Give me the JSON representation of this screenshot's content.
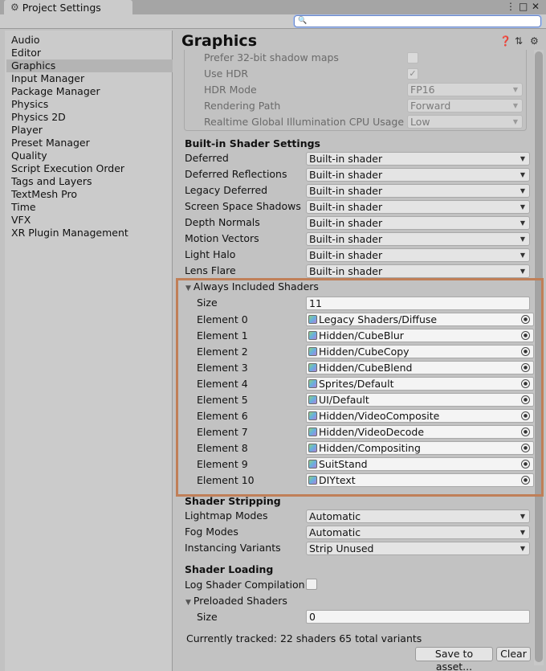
{
  "window": {
    "tab_title": "Project Settings",
    "tab_icon": "gear-icon",
    "controls": [
      "⋮",
      "□",
      "✕"
    ]
  },
  "search": {
    "value": "",
    "placeholder": ""
  },
  "sidebar": {
    "items": [
      {
        "label": "Audio"
      },
      {
        "label": "Editor"
      },
      {
        "label": "Graphics",
        "selected": true
      },
      {
        "label": "Input Manager"
      },
      {
        "label": "Package Manager"
      },
      {
        "label": "Physics"
      },
      {
        "label": "Physics 2D"
      },
      {
        "label": "Player"
      },
      {
        "label": "Preset Manager"
      },
      {
        "label": "Quality"
      },
      {
        "label": "Script Execution Order"
      },
      {
        "label": "Tags and Layers"
      },
      {
        "label": "TextMesh Pro"
      },
      {
        "label": "Time"
      },
      {
        "label": "VFX"
      },
      {
        "label": "XR Plugin Management"
      }
    ]
  },
  "main": {
    "title": "Graphics",
    "header_icons": [
      "help-icon",
      "preset-icon",
      "settings-icon"
    ],
    "tier": {
      "prefer_32bit_shadow_maps": {
        "label": "Prefer 32-bit shadow maps",
        "checked": false
      },
      "use_hdr": {
        "label": "Use HDR",
        "checked": true,
        "mark": "✓"
      },
      "hdr_mode": {
        "label": "HDR Mode",
        "value": "FP16"
      },
      "rendering_path": {
        "label": "Rendering Path",
        "value": "Forward"
      },
      "realtime_gi": {
        "label": "Realtime Global Illumination CPU Usage",
        "value": "Low"
      }
    },
    "builtin_shader_settings": {
      "title": "Built-in Shader Settings",
      "rows": [
        {
          "label": "Deferred",
          "value": "Built-in shader"
        },
        {
          "label": "Deferred Reflections",
          "value": "Built-in shader"
        },
        {
          "label": "Legacy Deferred",
          "value": "Built-in shader"
        },
        {
          "label": "Screen Space Shadows",
          "value": "Built-in shader"
        },
        {
          "label": "Depth Normals",
          "value": "Built-in shader"
        },
        {
          "label": "Motion Vectors",
          "value": "Built-in shader"
        },
        {
          "label": "Light Halo",
          "value": "Built-in shader"
        },
        {
          "label": "Lens Flare",
          "value": "Built-in shader"
        }
      ]
    },
    "always_included": {
      "title": "Always Included Shaders",
      "size_label": "Size",
      "size_value": "11",
      "elements": [
        {
          "label": "Element 0",
          "value": "Legacy Shaders/Diffuse"
        },
        {
          "label": "Element 1",
          "value": "Hidden/CubeBlur"
        },
        {
          "label": "Element 2",
          "value": "Hidden/CubeCopy"
        },
        {
          "label": "Element 3",
          "value": "Hidden/CubeBlend"
        },
        {
          "label": "Element 4",
          "value": "Sprites/Default"
        },
        {
          "label": "Element 5",
          "value": "UI/Default"
        },
        {
          "label": "Element 6",
          "value": "Hidden/VideoComposite"
        },
        {
          "label": "Element 7",
          "value": "Hidden/VideoDecode"
        },
        {
          "label": "Element 8",
          "value": "Hidden/Compositing"
        },
        {
          "label": "Element 9",
          "value": "SuitStand"
        },
        {
          "label": "Element 10",
          "value": "DIYtext"
        }
      ]
    },
    "shader_stripping": {
      "title": "Shader Stripping",
      "rows": [
        {
          "label": "Lightmap Modes",
          "value": "Automatic"
        },
        {
          "label": "Fog Modes",
          "value": "Automatic"
        },
        {
          "label": "Instancing Variants",
          "value": "Strip Unused"
        }
      ]
    },
    "shader_loading": {
      "title": "Shader Loading",
      "log_label": "Log Shader Compilation",
      "log_checked": false,
      "preloaded_title": "Preloaded Shaders",
      "size_label": "Size",
      "size_value": "0",
      "tracked": "Currently tracked: 22 shaders 65 total variants",
      "save_btn": "Save to asset...",
      "clear_btn": "Clear"
    }
  },
  "colors": {
    "highlight": "#c07f58",
    "selection": "#b4b4b4"
  }
}
